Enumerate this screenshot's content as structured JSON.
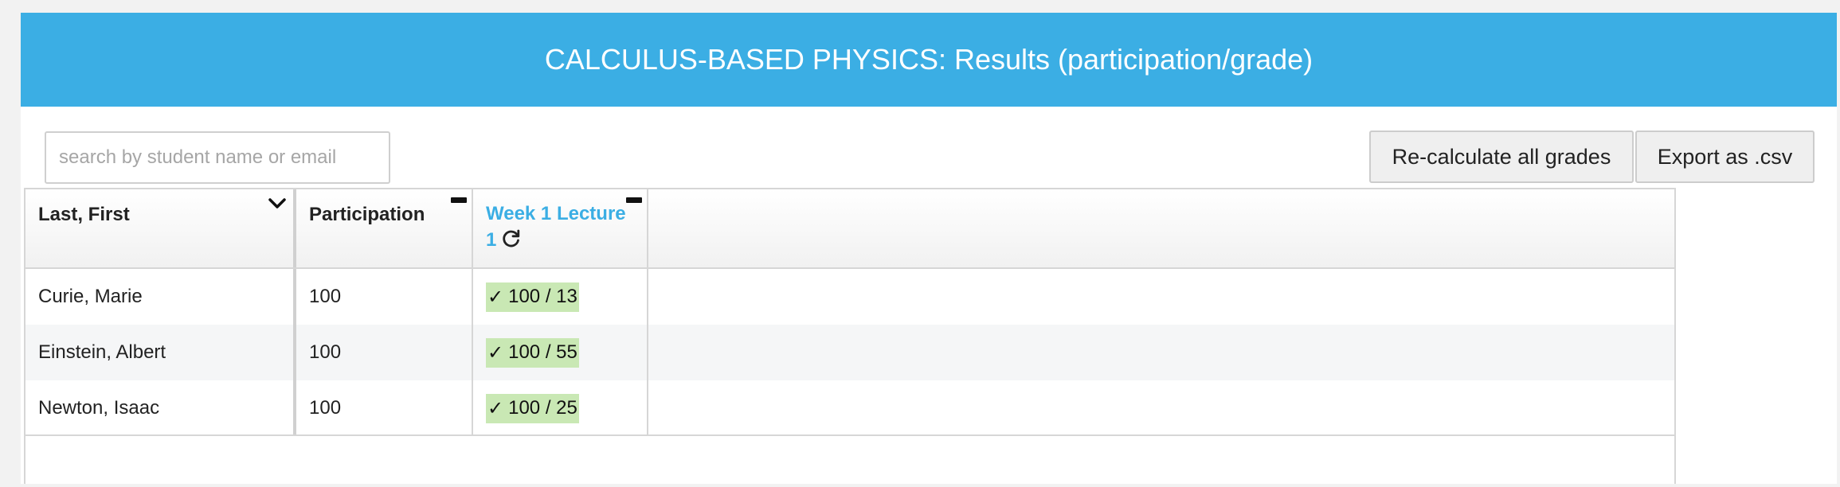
{
  "header": {
    "title": "CALCULUS-BASED PHYSICS: Results (participation/grade)"
  },
  "toolbar": {
    "search_placeholder": "search by student name or email",
    "search_value": "",
    "recalc_label": "Re-calculate all grades",
    "export_label": "Export as .csv"
  },
  "table": {
    "columns": {
      "name": "Last, First",
      "participation": "Participation",
      "week_line1": "Week 1 Lecture",
      "week_line2": "1"
    },
    "rows": [
      {
        "name": "Curie, Marie",
        "participation": "100",
        "check": "✓",
        "grade": "100 / 13"
      },
      {
        "name": "Einstein, Albert",
        "participation": "100",
        "check": "✓",
        "grade": "100 / 55"
      },
      {
        "name": "Newton, Isaac",
        "participation": "100",
        "check": "✓",
        "grade": "100 / 25"
      }
    ]
  },
  "icons": {
    "sort": "chevron-down-icon",
    "collapse": "minus-icon",
    "refresh": "refresh-icon"
  },
  "colors": {
    "header_bg": "#3baee4",
    "accent": "#3baee4",
    "grade_chip": "#c9e8b4"
  }
}
